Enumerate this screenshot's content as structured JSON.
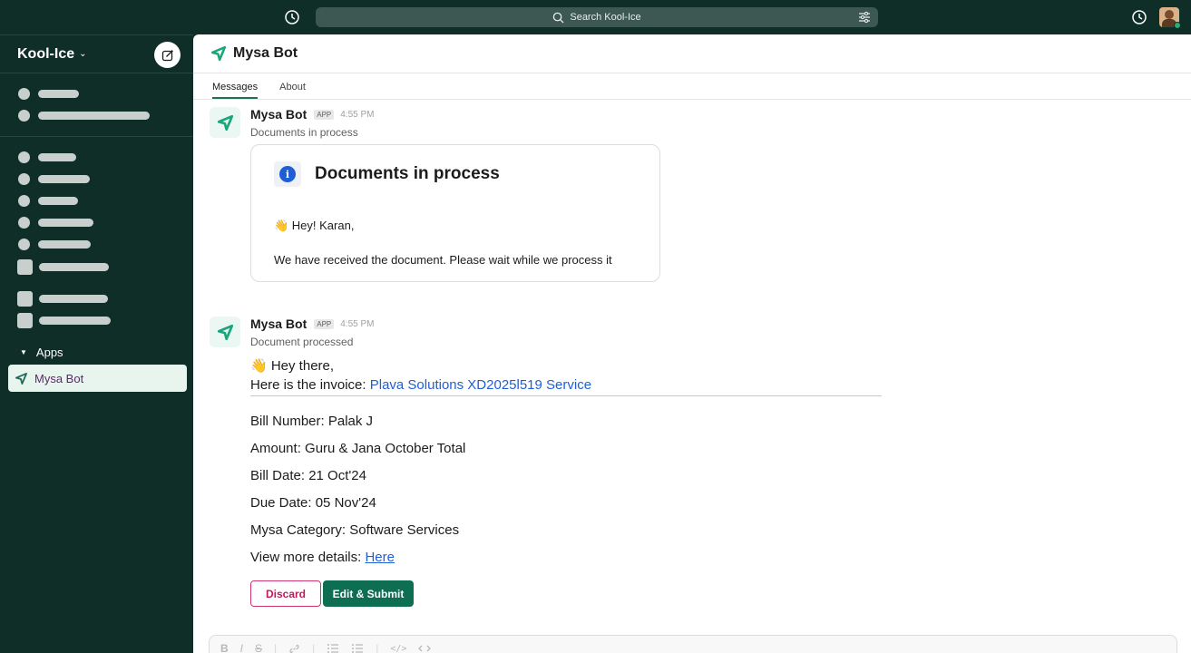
{
  "topbar": {
    "search_placeholder": "Search Kool-Ice"
  },
  "sidebar": {
    "workspace_name": "Kool-Ice",
    "apps_header": "Apps",
    "active_app": "Mysa Bot"
  },
  "channel": {
    "title": "Mysa Bot",
    "tabs": [
      {
        "label": "Messages"
      },
      {
        "label": "About"
      }
    ]
  },
  "messages": [
    {
      "sender": "Mysa Bot",
      "badge": "APP",
      "time": "4:55 PM",
      "subtext": "Documents in process",
      "card": {
        "title": "Documents in process",
        "greeting": "👋 Hey! Karan,",
        "body": "We have received the document. Please wait while we process it"
      }
    },
    {
      "sender": "Mysa Bot",
      "badge": "APP",
      "time": "4:55 PM",
      "subtext": "Document processed",
      "greeting": "👋 Hey there,",
      "invoice_prefix": "Here is the invoice: ",
      "invoice_link": "Plava Solutions XD2025l519 Service",
      "fields": [
        {
          "label": "Bill Number:",
          "value": "Palak J"
        },
        {
          "label": "Amount:",
          "value": "Guru & Jana October Total"
        },
        {
          "label": "Bill Date:",
          "value": "21 Oct'24"
        },
        {
          "label": "Due Date:",
          "value": "05 Nov'24"
        },
        {
          "label": "Mysa Category:",
          "value": "Software Services"
        }
      ],
      "details_label": "View more details: ",
      "details_link": "Here",
      "buttons": {
        "discard": "Discard",
        "submit": "Edit & Submit"
      }
    }
  ],
  "composer": {
    "toolbar": [
      "B",
      "I",
      "S",
      "|",
      "link",
      "|",
      "ordered-list",
      "bulleted-list",
      "|",
      "</>",
      "code-block"
    ]
  }
}
